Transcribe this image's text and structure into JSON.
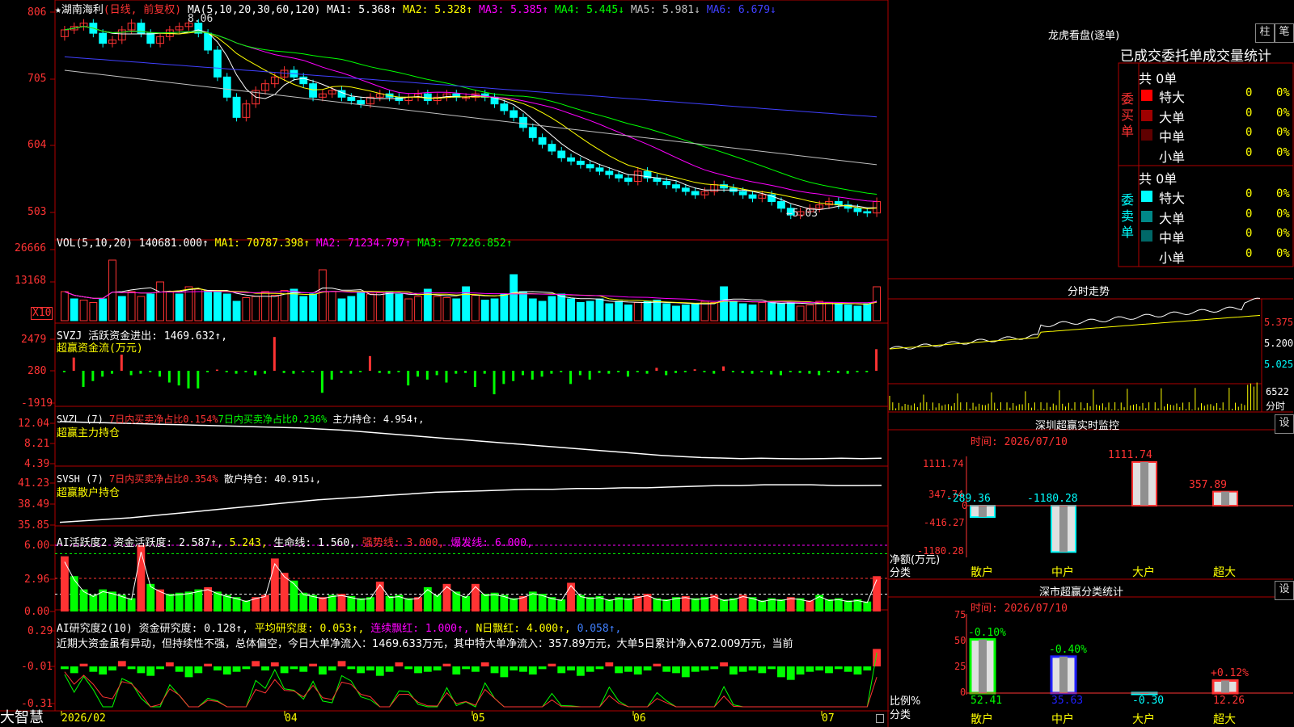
{
  "app": {
    "brand": "大智慧",
    "stock_name": "★湖南海利",
    "period_label": "(日线, 前复权)"
  },
  "price_pane": {
    "ma_header": "MA(5,10,20,30,60,120)",
    "mas": [
      {
        "label": "MA1: 5.368↑",
        "color": "#ffffff"
      },
      {
        "label": "MA2: 5.328↑",
        "color": "#ffff00"
      },
      {
        "label": "MA3: 5.385↑",
        "color": "#ff00ff"
      },
      {
        "label": "MA4: 5.445↓",
        "color": "#00ff00"
      },
      {
        "label": "MA5: 5.981↓",
        "color": "#c0c0c0"
      },
      {
        "label": "MA6: 6.679↓",
        "color": "#4040ff"
      }
    ],
    "y_ticks": [
      "806",
      "705",
      "604",
      "503"
    ],
    "high_annotation": "8.06",
    "low_annotation": "←5.03"
  },
  "vol_pane": {
    "header": "VOL(5,10,20)",
    "value": "140681.000↑",
    "ma1": "MA1: 70787.398↑",
    "ma2": "MA2: 71234.797↑",
    "ma3": "MA3: 77226.852↑",
    "y_ticks": [
      "26666",
      "13168"
    ],
    "unit": "X10"
  },
  "svzj_pane": {
    "header": "SVZJ",
    "item": "活跃资金进出: 1469.632↑,",
    "subtitle": "超赢资金流(万元)",
    "y_ticks": [
      "2479",
      "280",
      "-1919"
    ]
  },
  "svzl_pane": {
    "header": "SVZL (7)",
    "ratio1": "7日内买卖净占比0.154%",
    "ratio2": "7日内买卖净占比0.236%",
    "item": "主力持仓: 4.954↑,",
    "subtitle": "超赢主力持仓",
    "y_ticks": [
      "12.04",
      "8.21",
      "4.39"
    ]
  },
  "svsh_pane": {
    "header": "SVSH (7)",
    "ratio1": "7日内买卖净占比0.354%",
    "item": "散户持仓: 40.915↓,",
    "subtitle": "超赢散户持仓",
    "y_ticks": [
      "41.23",
      "38.49",
      "35.85"
    ]
  },
  "ai_active_pane": {
    "header": "AI活跃度2",
    "item1": "资金活跃度: 2.587↑,",
    "item2": "5.243,",
    "item3": "生命线: 1.560,",
    "item4": "强势线: 3.000,",
    "item5": "爆发线: 6.000,",
    "y_ticks": [
      "6.00",
      "2.96",
      "0.00"
    ]
  },
  "ai_research_pane": {
    "header": "AI研究度2(10)",
    "item1": "资金研究度: 0.128↑,",
    "item2": "平均研究度: 0.053↑,",
    "item3": "连续飘红: 1.000↑,",
    "item4": "N日飘红: 4.000↑,",
    "item5": "0.058↑,",
    "comment": "近期大资金虽有异动，但持续性不强，总体偏空，今日大单净流入：1469.633万元，其中特大单净流入：357.89万元，大单5日累计净入672.009万元，当前",
    "y_ticks": [
      "0.29",
      "-0.01",
      "-0.31"
    ]
  },
  "x_axis": {
    "labels": [
      "2026/02",
      "04",
      "05",
      "06",
      "07"
    ]
  },
  "right": {
    "dragon_title": "龙虎看盘(逐单)",
    "btn_zhu": "柱",
    "btn_bi": "笔",
    "tabs_title": "已成交委托单成交量统计",
    "buy_header": "共 0单",
    "buy_side_label": "委买单",
    "sell_header": "共 0单",
    "sell_side_label": "委卖单",
    "buy_rows": [
      {
        "label": "特大",
        "count": "0",
        "pct": "0%",
        "color": "#ff0000"
      },
      {
        "label": "大单",
        "count": "0",
        "pct": "0%",
        "color": "#a00000"
      },
      {
        "label": "中单",
        "count": "0",
        "pct": "0%",
        "color": "#600000"
      },
      {
        "label": "小单",
        "count": "0",
        "pct": "0%",
        "color": "#000000"
      }
    ],
    "sell_rows": [
      {
        "label": "特大",
        "count": "0",
        "pct": "0%",
        "color": "#00ffff"
      },
      {
        "label": "大单",
        "count": "0",
        "pct": "0%",
        "color": "#008888"
      },
      {
        "label": "中单",
        "count": "0",
        "pct": "0%",
        "color": "#006868"
      },
      {
        "label": "小单",
        "count": "0",
        "pct": "0%",
        "color": "#000000"
      }
    ],
    "intraday_title": "分时走势",
    "intraday_ticks": [
      "5.375",
      "5.200",
      "5.025"
    ],
    "intraday_vol": "6522",
    "intraday_vol_label": "分时",
    "monitor_title": "深圳超赢实时监控",
    "monitor_btn": "设",
    "monitor_time": "时间: 2026/07/10",
    "monitor_yticks": [
      "1111.74",
      "347.74",
      "0",
      "-416.27",
      "-1180.28"
    ],
    "monitor_ylabel": "净额(万元)",
    "monitor_xlabel": "分类",
    "monitor_categories": [
      "散户",
      "中户",
      "大户",
      "超大"
    ],
    "monitor_values": [
      -289.36,
      -1180.28,
      1111.74,
      357.89
    ],
    "monitor_value_labels": [
      "-289.36",
      "-1180.28",
      "1111.74",
      "357.89"
    ],
    "class_title": "深市超赢分类统计",
    "class_btn": "设",
    "class_time": "时间: 2026/07/10",
    "class_yticks": [
      "75",
      "50",
      "25",
      "0"
    ],
    "class_ylabel": "比例%",
    "class_xlabel": "分类",
    "class_categories": [
      "散户",
      "中户",
      "大户",
      "超大"
    ],
    "class_values": [
      52.41,
      35.63,
      -0.3,
      12.26
    ],
    "class_value_labels": [
      "52.41",
      "35.63",
      "-0.30",
      "12.26"
    ],
    "class_change_labels": [
      "-0.10%",
      "-0.40%",
      "",
      "+0.12%"
    ]
  },
  "colors": {
    "up": "#ff3333",
    "down": "#00ffff",
    "green": "#00ff00",
    "border": "#b00000"
  },
  "chart_data": [
    {
      "type": "candlestick",
      "title": "湖南海利",
      "ylim": [
        4.9,
        8.2
      ],
      "close": [
        7.9,
        7.95,
        8.0,
        7.85,
        7.7,
        7.75,
        7.9,
        8.0,
        7.85,
        7.7,
        7.8,
        7.9,
        7.95,
        8.0,
        7.85,
        7.6,
        7.2,
        6.9,
        6.6,
        6.8,
        7.0,
        7.1,
        7.2,
        7.3,
        7.2,
        7.1,
        6.9,
        6.95,
        7.0,
        6.9,
        6.85,
        6.8,
        6.9,
        6.95,
        6.9,
        6.85,
        6.9,
        6.95,
        6.85,
        6.9,
        6.95,
        6.9,
        6.9,
        6.95,
        6.9,
        6.8,
        6.7,
        6.6,
        6.45,
        6.3,
        6.2,
        6.1,
        6.0,
        5.95,
        5.9,
        5.85,
        5.8,
        5.75,
        5.7,
        5.65,
        5.8,
        5.7,
        5.65,
        5.6,
        5.55,
        5.5,
        5.45,
        5.5,
        5.6,
        5.55,
        5.5,
        5.45,
        5.4,
        5.45,
        5.35,
        5.25,
        5.15,
        5.2,
        5.25,
        5.3,
        5.35,
        5.3,
        5.25,
        5.2,
        5.18,
        5.35
      ],
      "open": [
        7.8,
        7.9,
        7.95,
        8.0,
        7.85,
        7.7,
        7.75,
        7.9,
        8.0,
        7.85,
        7.7,
        7.8,
        7.9,
        7.95,
        8.0,
        7.85,
        7.6,
        7.2,
        6.9,
        6.6,
        6.8,
        7.0,
        7.1,
        7.2,
        7.3,
        7.2,
        7.1,
        6.9,
        6.95,
        7.0,
        6.9,
        6.85,
        6.8,
        6.9,
        6.95,
        6.9,
        6.85,
        6.9,
        6.95,
        6.85,
        6.9,
        6.95,
        6.9,
        6.9,
        6.95,
        6.9,
        6.8,
        6.7,
        6.6,
        6.45,
        6.3,
        6.2,
        6.1,
        6.0,
        5.95,
        5.9,
        5.85,
        5.8,
        5.75,
        5.7,
        5.65,
        5.8,
        5.7,
        5.65,
        5.6,
        5.55,
        5.5,
        5.45,
        5.5,
        5.6,
        5.55,
        5.5,
        5.45,
        5.4,
        5.45,
        5.35,
        5.25,
        5.15,
        5.2,
        5.25,
        5.3,
        5.35,
        5.3,
        5.25,
        5.2,
        5.18
      ]
    },
    {
      "type": "bar",
      "title": "VOL",
      "ylim": [
        0,
        30000
      ],
      "values": [
        12000,
        9000,
        8500,
        7500,
        9000,
        25000,
        10000,
        12000,
        10000,
        11000,
        16000,
        12000,
        11000,
        14000,
        13000,
        12500,
        12000,
        11000,
        8000,
        9500,
        10000,
        12000,
        10500,
        12500,
        13000,
        10000,
        11000,
        21000,
        12000,
        9000,
        10000,
        12000,
        11000,
        11500,
        12000,
        11000,
        9000,
        10000,
        13000,
        10000,
        9500,
        9000,
        14000,
        10500,
        8500,
        9000,
        11000,
        19000,
        12000,
        9000,
        8000,
        10000,
        11000,
        9000,
        7500,
        8000,
        9000,
        7000,
        8000,
        6500,
        7500,
        8000,
        8500,
        7000,
        6000,
        6500,
        7000,
        8000,
        7500,
        14000,
        8000,
        7000,
        6500,
        7500,
        8000,
        7000,
        7500,
        6000,
        6500,
        8000,
        7500,
        6800,
        6500,
        6000,
        7000,
        14000
      ],
      "up_flags": [
        1,
        0,
        1,
        1,
        0,
        1,
        0,
        1,
        1,
        0,
        1,
        1,
        0,
        1,
        1,
        0,
        0,
        0,
        0,
        1,
        1,
        1,
        1,
        1,
        0,
        0,
        0,
        1,
        1,
        0,
        0,
        0,
        1,
        1,
        0,
        0,
        1,
        1,
        0,
        1,
        1,
        0,
        0,
        1,
        0,
        0,
        0,
        0,
        0,
        0,
        0,
        0,
        0,
        0,
        0,
        0,
        0,
        0,
        0,
        0,
        1,
        0,
        0,
        0,
        0,
        0,
        0,
        1,
        1,
        0,
        0,
        0,
        0,
        1,
        0,
        0,
        0,
        1,
        1,
        1,
        1,
        0,
        0,
        0,
        0,
        1
      ]
    },
    {
      "type": "bar",
      "title": "超赢资金流(万元)",
      "ylim": [
        -1919,
        2479
      ],
      "values": [
        -100,
        900,
        -1100,
        -700,
        -400,
        -200,
        1100,
        -300,
        -200,
        -100,
        -400,
        -800,
        -1000,
        -1200,
        -1200,
        -100,
        80,
        -100,
        -200,
        -100,
        -300,
        -200,
        2300,
        -150,
        -200,
        -100,
        -100,
        -1500,
        -600,
        -150,
        -200,
        -100,
        1000,
        -150,
        -200,
        -100,
        -1000,
        -400,
        -600,
        -300,
        -800,
        -200,
        -150,
        -1100,
        -200,
        -1600,
        -900,
        -700,
        -300,
        -600,
        -400,
        -200,
        -100,
        -900,
        -300,
        -600,
        -150,
        -200,
        -100,
        -400,
        -100,
        -200,
        200,
        -300,
        -150,
        -100,
        100,
        -100,
        -200,
        300,
        -100,
        -150,
        -200,
        -100,
        -250,
        -300,
        -100,
        -150,
        -200,
        -300,
        -100,
        -150,
        -200,
        -100,
        -100,
        1469
      ]
    },
    {
      "type": "line",
      "title": "超赢主力持仓",
      "ylim": [
        4.39,
        12.04
      ],
      "values": [
        11.9,
        11.8,
        11.7,
        11.6,
        11.5,
        11.4,
        11.3,
        11.2,
        11.1,
        11.0,
        10.9,
        10.8,
        10.7,
        10.5,
        10.3,
        10.0,
        9.7,
        9.4,
        9.1,
        8.8,
        8.5,
        8.2,
        7.9,
        7.6,
        7.3,
        7.0,
        6.7,
        6.4,
        6.1,
        5.8,
        5.5,
        5.3,
        5.1,
        5.0,
        4.9,
        4.95,
        4.9,
        4.85,
        4.9,
        4.95,
        4.9,
        4.95
      ]
    },
    {
      "type": "line",
      "title": "超赢散户持仓",
      "ylim": [
        35.85,
        41.23
      ],
      "values": [
        36.0,
        36.2,
        36.4,
        36.6,
        36.9,
        37.2,
        37.5,
        37.8,
        38.1,
        38.4,
        38.7,
        39.0,
        39.2,
        39.4,
        39.6,
        39.8,
        40.0,
        40.1,
        40.2,
        40.3,
        40.4,
        40.4,
        40.5,
        40.5,
        40.6,
        40.6,
        40.7,
        40.8,
        40.9,
        40.9,
        41.0,
        41.0,
        41.0,
        40.9,
        40.9,
        40.92
      ]
    },
    {
      "type": "bar",
      "title": "AI活跃度2",
      "ylim": [
        0,
        6.0
      ],
      "values": [
        5.0,
        3.2,
        2.0,
        1.5,
        2.0,
        1.8,
        1.5,
        1.2,
        6.0,
        2.5,
        2.0,
        1.6,
        1.7,
        1.8,
        2.0,
        2.2,
        1.8,
        1.5,
        1.3,
        1.0,
        1.3,
        1.5,
        4.8,
        3.5,
        2.8,
        1.7,
        1.5,
        1.3,
        1.5,
        1.6,
        1.4,
        1.2,
        1.3,
        2.7,
        1.4,
        1.5,
        1.2,
        1.3,
        2.2,
        1.5,
        2.5,
        1.8,
        1.4,
        2.5,
        1.6,
        1.7,
        1.5,
        1.2,
        1.4,
        1.8,
        1.6,
        1.3,
        1.1,
        2.6,
        1.5,
        1.3,
        1.4,
        1.1,
        1.3,
        1.2,
        1.4,
        1.6,
        1.2,
        1.1,
        1.3,
        1.4,
        1.2,
        1.3,
        1.5,
        1.1,
        1.2,
        1.5,
        1.3,
        1.0,
        1.2,
        1.1,
        1.3,
        1.2,
        1.0,
        1.5,
        1.1,
        1.2,
        1.0,
        1.1,
        0.9,
        3.2
      ],
      "up_flags": [
        1,
        0,
        0,
        0,
        0,
        0,
        0,
        0,
        1,
        0,
        1,
        0,
        0,
        0,
        0,
        1,
        0,
        0,
        0,
        0,
        1,
        1,
        1,
        1,
        0,
        0,
        0,
        1,
        0,
        1,
        0,
        0,
        0,
        1,
        0,
        0,
        0,
        1,
        0,
        0,
        1,
        0,
        0,
        1,
        0,
        0,
        0,
        0,
        1,
        0,
        0,
        0,
        0,
        1,
        0,
        0,
        0,
        0,
        0,
        0,
        1,
        1,
        0,
        0,
        0,
        1,
        0,
        0,
        1,
        0,
        0,
        1,
        0,
        0,
        0,
        0,
        1,
        0,
        1,
        0,
        0,
        0,
        0,
        0,
        0,
        1
      ]
    },
    {
      "type": "bar",
      "title": "AI研究度2(10)",
      "ylim": [
        -0.31,
        0.29
      ],
      "values": [
        -0.02,
        -0.05,
        0.02,
        -0.04,
        -0.06,
        -0.03,
        0.04,
        -0.02,
        -0.05,
        -0.07,
        -0.02,
        0.03,
        -0.04,
        -0.08,
        -0.05,
        0.02,
        -0.03,
        -0.06,
        -0.04,
        -0.02,
        0.04,
        -0.03,
        0.03,
        -0.05,
        -0.02,
        -0.04,
        0.02,
        -0.06,
        -0.03,
        0.04,
        -0.02,
        -0.05,
        -0.03,
        -0.07,
        -0.04,
        0.03,
        -0.02,
        -0.05,
        -0.04,
        -0.03,
        0.02,
        -0.06,
        -0.02,
        -0.04,
        0.03,
        -0.05,
        -0.08,
        -0.03,
        -0.04,
        -0.06,
        -0.02,
        0.02,
        -0.05,
        -0.03,
        -0.07,
        -0.04,
        -0.02,
        0.03,
        -0.05,
        -0.04,
        -0.06,
        -0.03,
        0.02,
        -0.04,
        -0.05,
        -0.08,
        -0.04,
        -0.03,
        -0.02,
        0.03,
        -0.06,
        -0.04,
        -0.03,
        -0.05,
        -0.02,
        -0.08,
        -0.1,
        -0.06,
        -0.04,
        -0.03,
        -0.05,
        -0.02,
        -0.04,
        -0.06,
        -0.03,
        0.13
      ]
    }
  ]
}
